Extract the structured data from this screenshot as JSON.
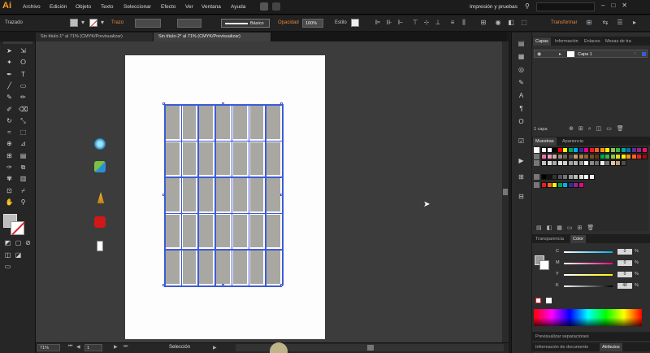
{
  "app": {
    "logo": "Ai"
  },
  "menu": [
    "Archivo",
    "Edición",
    "Objeto",
    "Texto",
    "Seleccionar",
    "Efecto",
    "Ver",
    "Ventana",
    "Ayuda"
  ],
  "workspace": "Impresión y pruebas",
  "control": {
    "mode_label": "Trazado",
    "trazo_label": "Trazo",
    "stroke_style": "Básico",
    "opacity_label": "Opacidad",
    "opacity_value": "100%",
    "style_label": "Estilo",
    "transform_label": "Transformar"
  },
  "tabs": [
    "Sin título-1* al 71% (CMYK/Previsualizar)",
    "Sin título-2* al 71% (CMYK/Previsualizar)"
  ],
  "status": {
    "zoom": "71%",
    "page": "1",
    "mode": "Selección"
  },
  "panels": {
    "layers_tabs": [
      "Capas",
      "Información",
      "Enlaces",
      "Mesas de tra"
    ],
    "layer_name": "Capa 1",
    "layer_count": "1 capa",
    "swatch_tabs": [
      "Muestras",
      "Apariencia"
    ],
    "color_tabs": [
      "Transparencia",
      "Color"
    ],
    "color_labels": [
      "C",
      "M",
      "Y",
      "K"
    ],
    "color_values": [
      "0",
      "0",
      "0",
      "40"
    ],
    "separations_tab": "Previsualizar separaciones",
    "bottom_tabs": [
      "Información de documento",
      "Atributos"
    ]
  },
  "colors": {
    "accent": "#f7a11a",
    "selection": "#3d5bd6",
    "cell_fill": "#a8a7a2"
  },
  "swatch_rows": [
    [
      "#ffffff",
      "#ffffff",
      "#000000",
      "#ff0000",
      "#ffff00",
      "#00a651",
      "#00aeef",
      "#2e3192",
      "#ec008c",
      "#ed1c24",
      "#f26522",
      "#f7941d",
      "#fff200",
      "#8dc63f",
      "#39b54a",
      "#00a99d",
      "#0072bc",
      "#662d91",
      "#92278f",
      "#ee145b"
    ],
    [
      "#f06eaa",
      "#f49ac1",
      "#c7b299",
      "#998675",
      "#736357",
      "#534741",
      "#c69c6d",
      "#a67c52",
      "#8c6239",
      "#754c24",
      "#603913",
      "#00a651",
      "#39b54a",
      "#8dc63f",
      "#d7df23",
      "#fff200",
      "#f7941d",
      "#f26522",
      "#ed1c24",
      "#9e0b0f"
    ],
    [
      "#c2c2c2",
      "#d9d9d9",
      "#aaaaaa",
      "#e0e0e0",
      "#cccccc",
      "#a0a0a0",
      "#b5b5b5",
      "#999999",
      "#ffffff",
      "#8a8a8a",
      "#707070",
      "#ededed",
      "#777777",
      "#e4c29b",
      "#c0a070",
      "#4f4f4f"
    ],
    [
      "#000000",
      "#111111",
      "#333333",
      "#555555",
      "#777777",
      "#999999",
      "#bbbbbb",
      "#dddddd",
      "#ffffff",
      "#eeeeee"
    ],
    [
      "#ed1c24",
      "#f26522",
      "#fff200",
      "#00a651",
      "#00aeef",
      "#2e3192",
      "#92278f",
      "#ec008c"
    ]
  ]
}
